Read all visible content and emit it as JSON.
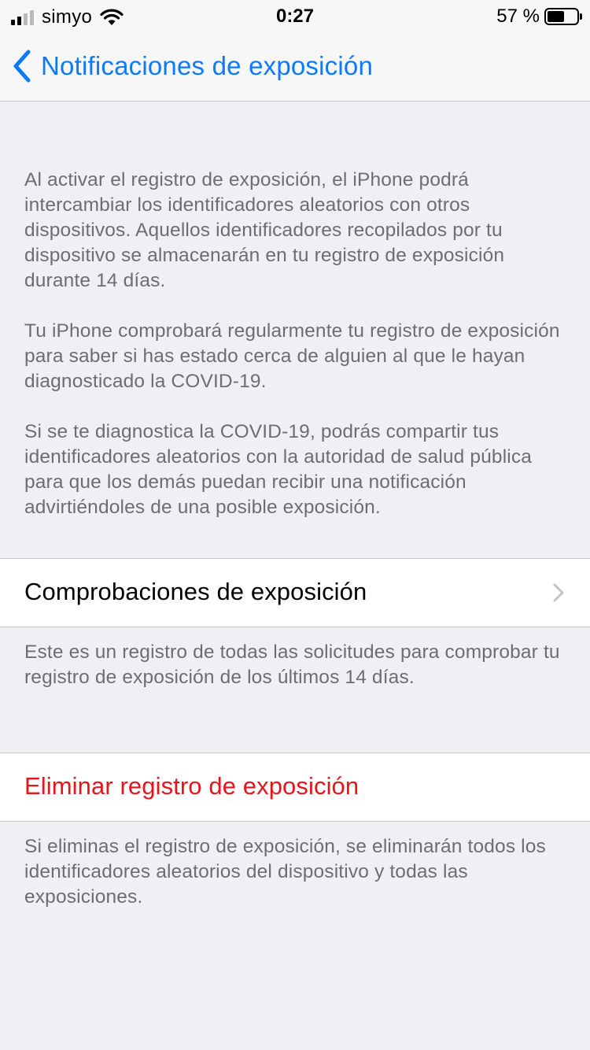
{
  "status_bar": {
    "carrier": "simyo",
    "time": "0:27",
    "battery_percent": "57 %",
    "battery_level": 0.57,
    "signal_bars_filled": 2,
    "signal_bars_total": 4
  },
  "nav": {
    "back_label": "Notificaciones de exposición",
    "accent_color": "#0a7aff"
  },
  "intro": {
    "paragraphs": [
      "Al activar el registro de exposición, el iPhone podrá intercambiar los identificadores aleatorios con otros dispositivos. Aquellos identificadores recopilados por tu dispositivo se almacenarán en tu registro de exposición durante 14 días.",
      "Tu iPhone comprobará regularmente tu registro de exposición para saber si has estado cerca de alguien al que le hayan diagnosticado la COVID-19.",
      "Si se te diagnostica la COVID-19, podrás compartir tus identificadores aleatorios con la autoridad de salud pública para que los demás puedan recibir una notificación advirtiéndoles de una posible exposición."
    ]
  },
  "checks_cell": {
    "label": "Comprobaciones de exposición",
    "footer": "Este es un registro de todas las solicitudes para comprobar tu registro de exposición de los últimos 14 días."
  },
  "delete_cell": {
    "label": "Eliminar registro de exposición",
    "color": "#e8141b",
    "footer": "Si eliminas el registro de exposición, se eliminarán todos los identificadores aleatorios del dispositivo y todas las exposiciones."
  }
}
